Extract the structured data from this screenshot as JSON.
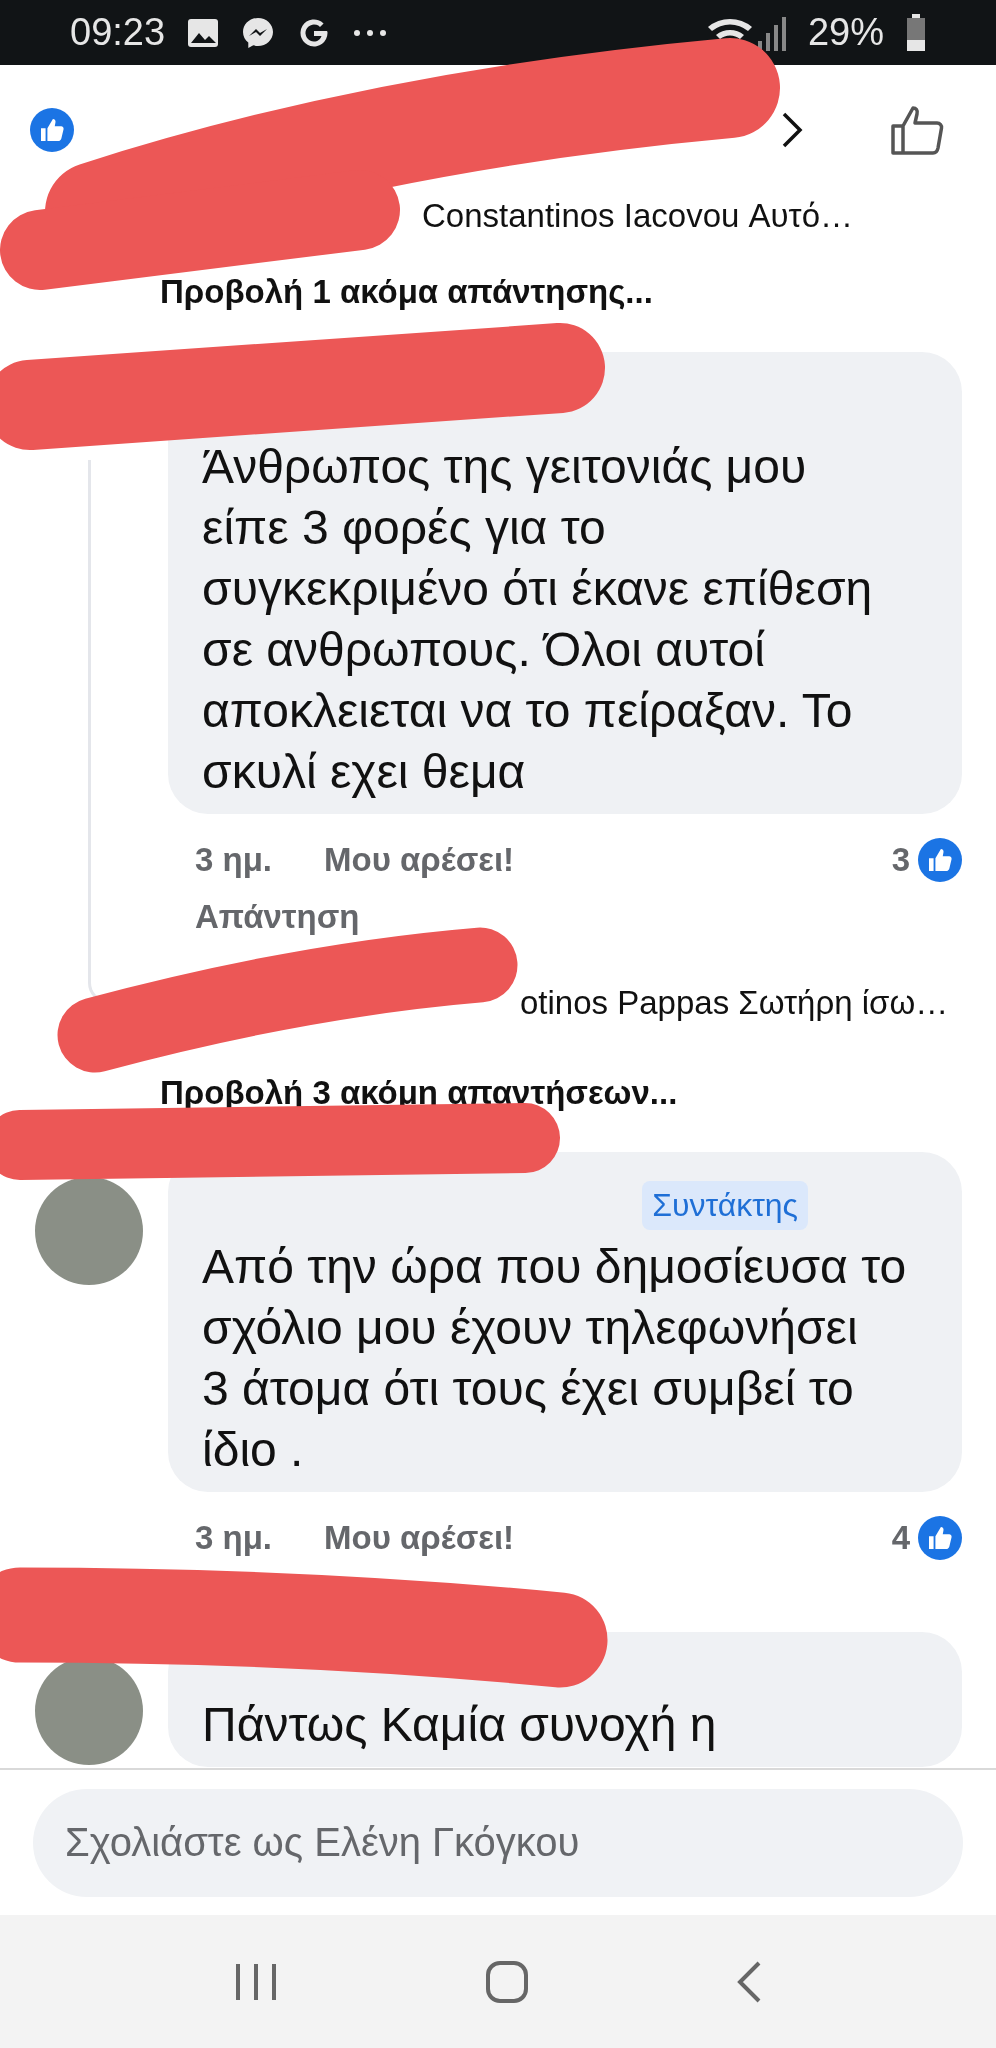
{
  "status_bar": {
    "time": "09:23",
    "battery": "29%"
  },
  "reply_preview_1": {
    "text": "Constantinos Iacovou Αυτό…"
  },
  "more_replies_1": "Προβολή 1 ακόμα απάντησης...",
  "comment_1": {
    "text": "Άνθρωπος της γειτονιάς μου\nείπε 3 φορές για το\nσυγκεκριμένο ότι έκανε επίθεση\nσε ανθρωπους. Όλοι αυτοί\nαποκλειεται να το πείραξαν. Το\nσκυλί εχει θεμα",
    "time": "3 ημ.",
    "like_label": "Μου αρέσει!",
    "like_count": "3",
    "reply_label": "Απάντηση"
  },
  "reply_preview_2": {
    "text": "otinos Pappas Σωτήρη ίσω…"
  },
  "more_replies_2": "Προβολή 3 ακόμη απαντήσεων...",
  "comment_2": {
    "badge": "Συντάκτης",
    "text": "Από την ώρα που δημοσίευσα το\nσχόλιο μου έχουν τηλεφωνήσει\n3 άτομα ότι τους έχει συμβεί το\nίδιο .",
    "time": "3 ημ.",
    "like_label": "Μου αρέσει!",
    "like_count": "4"
  },
  "comment_3": {
    "text": "Πάντως Καμία συνοχή η"
  },
  "composer": {
    "placeholder": "Σχολιάστε ως Ελένη Γκόγκου"
  }
}
